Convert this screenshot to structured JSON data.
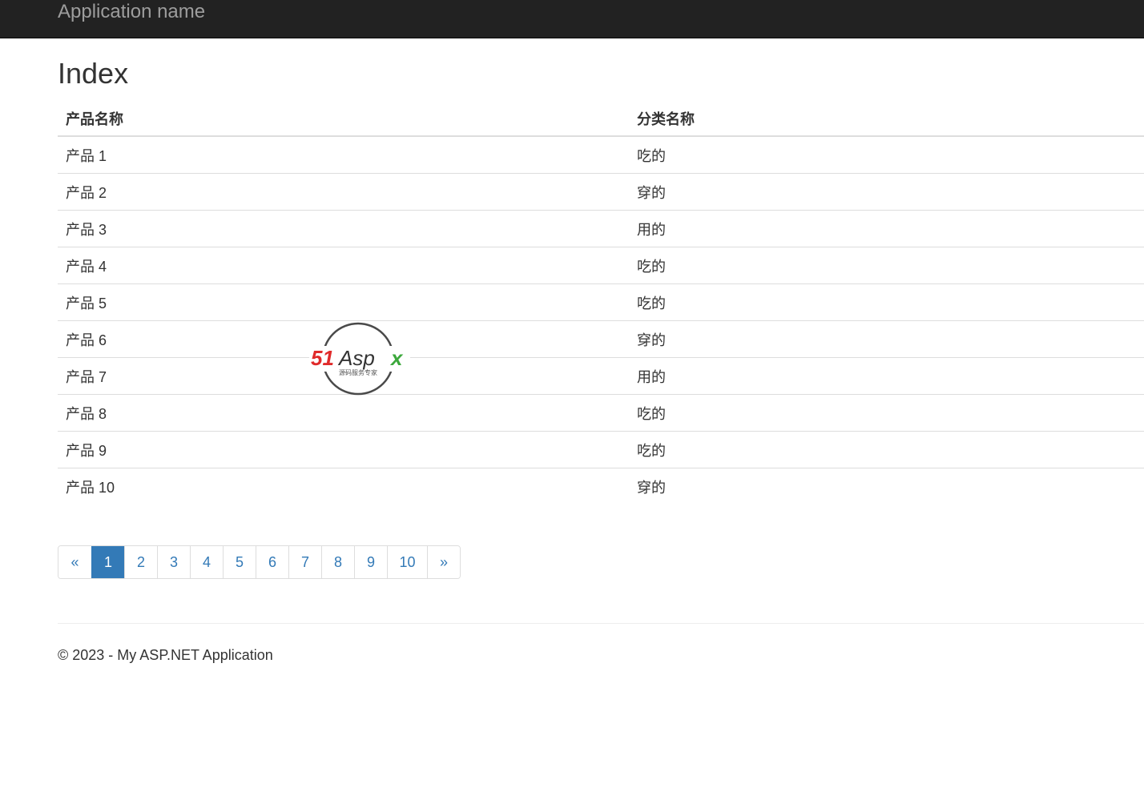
{
  "header": {
    "brand": "Application name"
  },
  "page": {
    "title": "Index"
  },
  "table": {
    "columns": [
      "产品名称",
      "分类名称"
    ],
    "rows": [
      [
        "产品 1",
        "吃的"
      ],
      [
        "产品 2",
        "穿的"
      ],
      [
        "产品 3",
        "用的"
      ],
      [
        "产品 4",
        "吃的"
      ],
      [
        "产品 5",
        "吃的"
      ],
      [
        "产品 6",
        "穿的"
      ],
      [
        "产品 7",
        "用的"
      ],
      [
        "产品 8",
        "吃的"
      ],
      [
        "产品 9",
        "吃的"
      ],
      [
        "产品 10",
        "穿的"
      ]
    ]
  },
  "pagination": {
    "prev": "«",
    "next": "»",
    "pages": [
      "1",
      "2",
      "3",
      "4",
      "5",
      "6",
      "7",
      "8",
      "9",
      "10"
    ],
    "active_page": "1"
  },
  "footer": {
    "text": "© 2023 - My ASP.NET Application"
  },
  "watermark": {
    "logo_text": "51Aspx",
    "tagline": "源码服务专家"
  },
  "colors": {
    "navbar_bg": "#222222",
    "brand_text": "#9d9d9d",
    "link": "#337ab7",
    "active_page_bg": "#337ab7",
    "watermark_red": "#e02a2a",
    "watermark_green": "#3ca83c"
  }
}
